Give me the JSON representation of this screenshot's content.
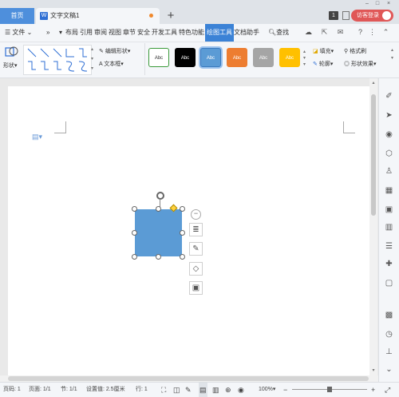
{
  "tabs": {
    "home": "首页",
    "document": "文字文稿1",
    "new_tab": "+",
    "page_count": "1",
    "login": "访客登录"
  },
  "window_controls": {
    "minimize": "–",
    "restore": "□",
    "close": "×"
  },
  "menu": {
    "file": "文件",
    "more": "»",
    "items": [
      "布局",
      "引用",
      "审阅",
      "视图",
      "章节",
      "安全",
      "开发工具",
      "特色功能",
      "绘图工具",
      "文档助手"
    ],
    "active": "绘图工具",
    "search": "查找",
    "help": "?"
  },
  "ribbon": {
    "shape_label": "形状",
    "edit_shape": "编辑形状",
    "text_box": "文本框",
    "styles": [
      {
        "label": "Abc",
        "bg": "#ffffff",
        "fg": "#333333",
        "border": "#3a9a3a"
      },
      {
        "label": "Abc",
        "bg": "#000000",
        "fg": "#ffffff",
        "border": "#000000"
      },
      {
        "label": "Abc",
        "bg": "#5b9bd5",
        "fg": "#ffffff",
        "border": "#3d7bbf"
      },
      {
        "label": "Abc",
        "bg": "#ed7d31",
        "fg": "#ffffff",
        "border": "#ed7d31"
      },
      {
        "label": "Abc",
        "bg": "#a5a5a5",
        "fg": "#ffffff",
        "border": "#a5a5a5"
      },
      {
        "label": "Abc",
        "bg": "#ffc000",
        "fg": "#ffffff",
        "border": "#ffc000"
      }
    ],
    "fill": "填充",
    "format_painter": "格式刷",
    "outline": "轮廓",
    "shape_effects": "形状效果"
  },
  "status": {
    "page_num": "页码: 1",
    "pages": "页面: 1/1",
    "section": "节: 1/1",
    "setting": "设置值: 2.5厘米",
    "row": "行: 1",
    "zoom": "100%",
    "zoom_minus": "−",
    "zoom_plus": "+"
  },
  "colors": {
    "accent": "#3b82d6",
    "shape_fill": "#5b9bd5",
    "login_red": "#e05757",
    "tab_bg": "#4e8fdc"
  }
}
